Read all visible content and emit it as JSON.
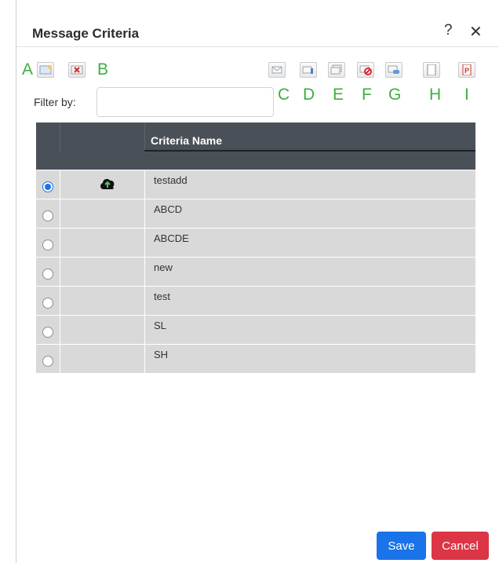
{
  "dialog": {
    "title": "Message Criteria",
    "help_label": "?",
    "close_label": "✕"
  },
  "annotations": {
    "a": "A",
    "b": "B",
    "c": "C",
    "d": "D",
    "e": "E",
    "f": "F",
    "g": "G",
    "h": "H",
    "i": "I"
  },
  "toolbar": {
    "left_buttons": [
      "add-criteria-icon",
      "delete-criteria-icon"
    ],
    "right_buttons": [
      "message-icon",
      "message-info-icon",
      "message-stack-icon",
      "message-block-icon",
      "message-link-icon",
      "blank-page-icon",
      "pdf-page-icon"
    ]
  },
  "filter": {
    "label": "Filter by:",
    "value": "",
    "placeholder": ""
  },
  "table": {
    "header": "Criteria Name",
    "rows": [
      {
        "name": "testadd",
        "selected": true,
        "status_icon": "cloud-upload-icon"
      },
      {
        "name": "ABCD",
        "selected": false
      },
      {
        "name": "ABCDE",
        "selected": false
      },
      {
        "name": "new",
        "selected": false
      },
      {
        "name": "test",
        "selected": false
      },
      {
        "name": "SL",
        "selected": false
      },
      {
        "name": "SH",
        "selected": false
      }
    ]
  },
  "actions": {
    "save_label": "Save",
    "cancel_label": "Cancel"
  },
  "colors": {
    "annotation_green": "#3fae3f",
    "header_bg": "#4a5058",
    "row_bg": "#d9d9d9",
    "save_blue": "#1a73e8",
    "cancel_red": "#dc3545"
  }
}
